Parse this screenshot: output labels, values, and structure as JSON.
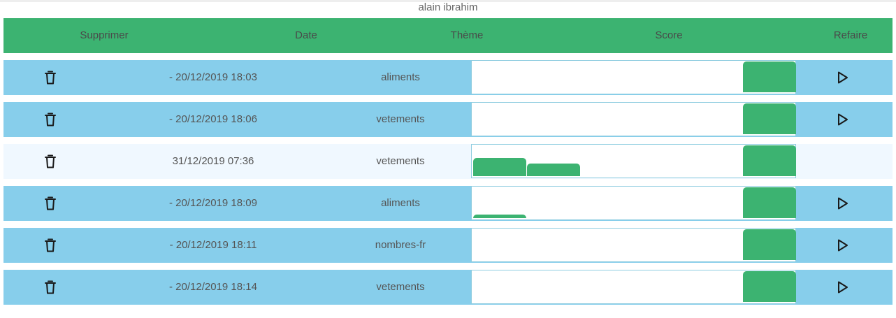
{
  "user": {
    "name": "alain ibrahim"
  },
  "header": {
    "delete": "Supprimer",
    "date": "Date",
    "theme": "Thème",
    "score": "Score",
    "redo": "Refaire"
  },
  "colors": {
    "header_bg": "#3cb371",
    "row_bg": "#87ceeb",
    "row_bg_light": "#f0f8ff",
    "bar": "#3cb371"
  },
  "rows": [
    {
      "date": "- 20/12/2019 18:03",
      "theme": "aliments",
      "score_bars": [],
      "has_redo": true
    },
    {
      "date": "- 20/12/2019 18:06",
      "theme": "vetements",
      "score_bars": [],
      "has_redo": true
    },
    {
      "date": "31/12/2019 07:36",
      "theme": "vetements",
      "score_bars": [
        0.59,
        0.4
      ],
      "has_redo": false
    },
    {
      "date": "- 20/12/2019 18:09",
      "theme": "aliments",
      "score_bars": [
        0.11
      ],
      "has_redo": true
    },
    {
      "date": "- 20/12/2019 18:11",
      "theme": "nombres-fr",
      "score_bars": [],
      "has_redo": true
    },
    {
      "date": "- 20/12/2019 18:14",
      "theme": "vetements",
      "score_bars": [],
      "has_redo": true
    }
  ]
}
